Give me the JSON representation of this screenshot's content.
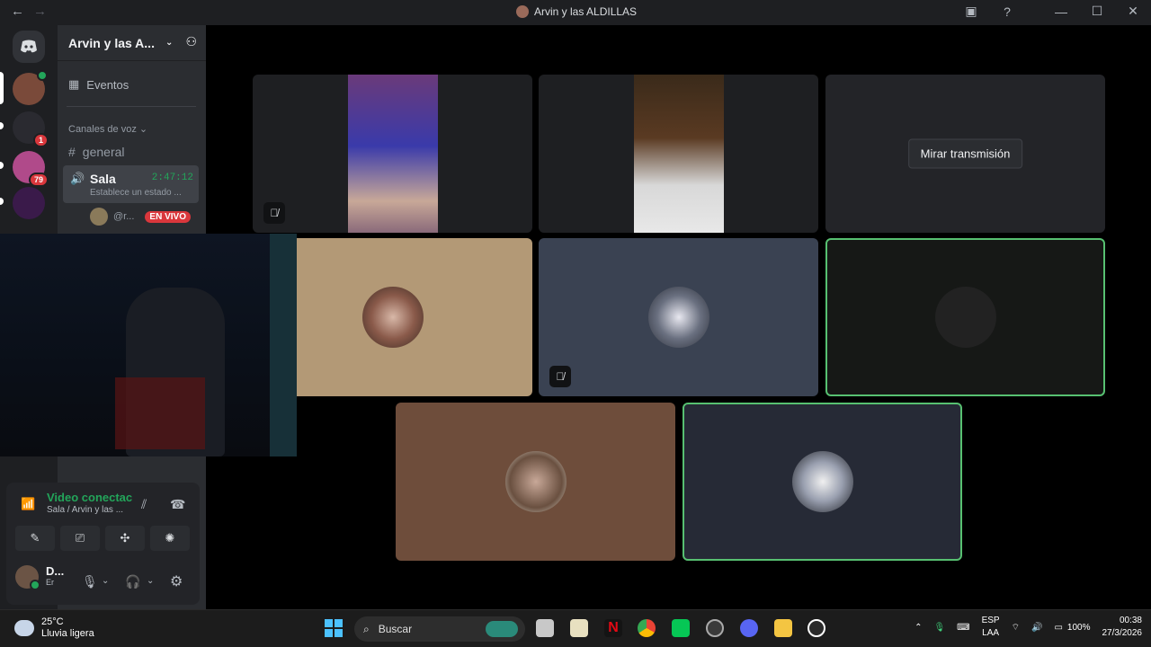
{
  "window": {
    "title": "Arvin y las ALDILLAS",
    "nav_back": "←",
    "nav_forward": "→",
    "icons": {
      "screen": "▣",
      "help": "?",
      "minimize": "—",
      "maximize": "☐",
      "close": "✕"
    }
  },
  "servers": {
    "home_icon": "discord-logo",
    "badges": [
      "1",
      "79"
    ]
  },
  "sidebar": {
    "guild_name": "Arvin y las A...",
    "chevron": "⌄",
    "invite_icon": "⚇",
    "events_label": "Eventos",
    "category_label": "Canales de voz",
    "channels": [
      {
        "name": "general",
        "icon": "#"
      },
      {
        "name": "Sala",
        "icon": "🔊",
        "timer": "2:47:12",
        "status": "Establece un estado ..."
      }
    ],
    "member": {
      "name": "@r...",
      "live_label": "EN VIVO"
    }
  },
  "voice_panel": {
    "status": "Video conectac",
    "location": "Sala / Arvin y las ...",
    "buttons": [
      "camera-off",
      "screen-share",
      "activities",
      "soundboard"
    ],
    "user_name": "D...",
    "user_sub": "Er"
  },
  "stage": {
    "watch_label": "Mirar transmisión"
  },
  "taskbar": {
    "temperature": "25°C",
    "weather_desc": "Lluvia ligera",
    "search_placeholder": "Buscar",
    "language_top": "ESP",
    "language_bottom": "LAA",
    "battery": "100%",
    "time": "00:38",
    "date": "27/3/2026"
  },
  "colors": {
    "accent_green": "#23a55a",
    "live_red": "#da373c",
    "speaking_border": "#57c071"
  }
}
